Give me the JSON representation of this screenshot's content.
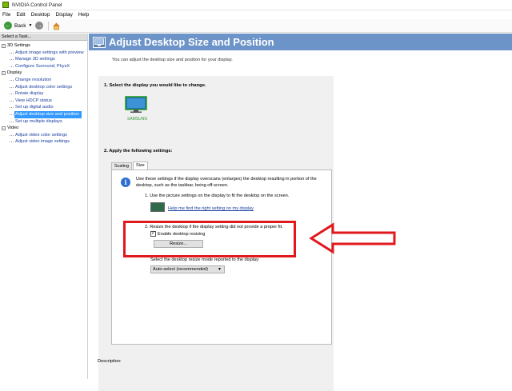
{
  "window": {
    "title": "NVIDIA Control Panel"
  },
  "menu": [
    "File",
    "Edit",
    "Desktop",
    "Display",
    "Help"
  ],
  "toolbar": {
    "back_label": "Back"
  },
  "sidebar": {
    "task_header": "Select a Task...",
    "tree": [
      {
        "category": "3D Settings",
        "items": [
          "Adjust image settings with preview",
          "Manage 3D settings",
          "Configure Surround, PhysX"
        ]
      },
      {
        "category": "Display",
        "items": [
          "Change resolution",
          "Adjust desktop color settings",
          "Rotate display",
          "View HDCP status",
          "Set up digital audio",
          "Adjust desktop size and position",
          "Set up multiple displays"
        ]
      },
      {
        "category": "Video",
        "items": [
          "Adjust video color settings",
          "Adjust video image settings"
        ]
      }
    ],
    "selected": "Adjust desktop size and position"
  },
  "page": {
    "title": "Adjust Desktop Size and Position",
    "subtitle": "You can adjust the desktop size and position for your display.",
    "section1": "1. Select the display you would like to change.",
    "display_name": "SAMSUNG",
    "section2": "2. Apply the following settings:",
    "tabs": [
      "Scaling",
      "Size"
    ],
    "active_tab": "Size",
    "info_text": "Use these settings if the display overscans (enlarges) the desktop resulting in portion of the desktop, such as the taskbar, being off-screen.",
    "step1": "1. Use the picture settings on the display to fit the desktop on the screen.",
    "help_link": "Help me find the right setting on my display",
    "step2": "2. Resize the desktop if the display setting did not provide a proper fit.",
    "enable_label": "Enable desktop resizing",
    "enable_checked": true,
    "resize_button": "Resize...",
    "mode_label": "Select the desktop resize mode reported to the display:",
    "mode_value": "Auto-select (recommended)",
    "description_label": "Description:"
  },
  "colors": {
    "banner": "#6d94c8",
    "highlight": "#e0191e",
    "selection": "#3399ff"
  }
}
